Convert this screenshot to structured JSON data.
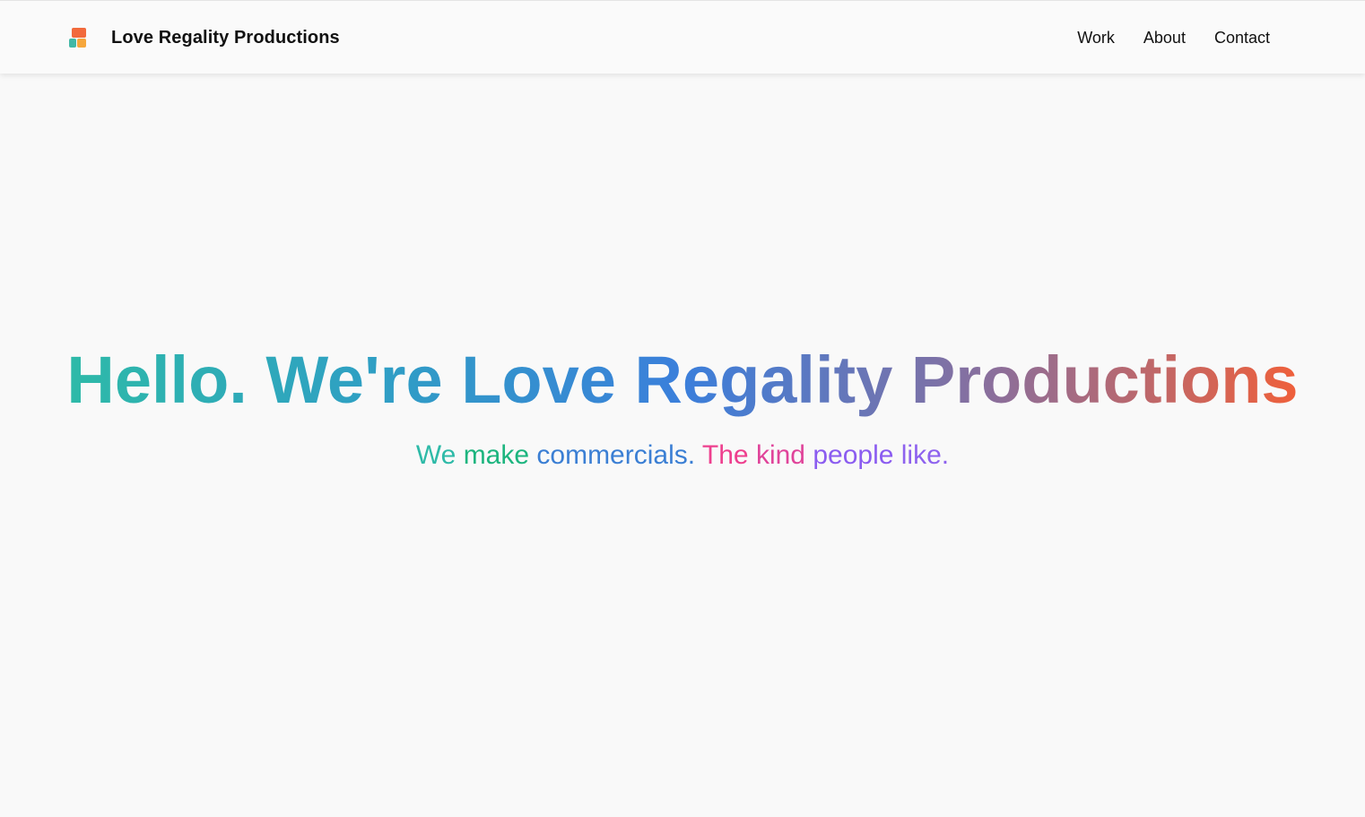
{
  "header": {
    "brand_name": "Love Regality Productions",
    "logo_icon": "stacked-blocks-logo-icon",
    "nav": [
      {
        "label": "Work"
      },
      {
        "label": "About"
      },
      {
        "label": "Contact"
      }
    ]
  },
  "hero": {
    "headline": "Hello. We're Love Regality Productions",
    "headline_gradient": [
      "#2ebaa8",
      "#2f9fc4",
      "#3b7fdb",
      "#8a6f9c",
      "#f0603a"
    ],
    "tagline_words": [
      {
        "text": "We",
        "color": "#2ebaa8"
      },
      {
        "text": "make",
        "color": "#1db57f"
      },
      {
        "text": "commercials.",
        "color": "#3b7fd4"
      },
      {
        "text": "The",
        "color": "#ee3f8e"
      },
      {
        "text": "kind",
        "color": "#e0449a"
      },
      {
        "text": "people",
        "color": "#8b5cf0"
      },
      {
        "text": "like.",
        "color": "#8e62ee"
      }
    ]
  },
  "colors": {
    "background": "#f9f9f9",
    "navbar_background": "#fafafa",
    "text": "#111111"
  }
}
